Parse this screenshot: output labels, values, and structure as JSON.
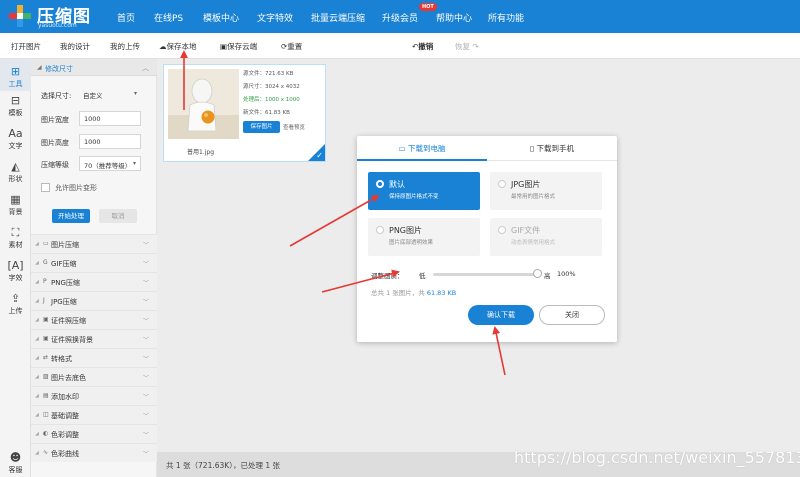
{
  "nav": {
    "logo_text": "压缩图",
    "logo_sub": "yasuotu.com",
    "items": [
      "首页",
      "在线PS",
      "模板中心",
      "文字特效",
      "批量云端压缩",
      "升级会员",
      "帮助中心",
      "所有功能"
    ],
    "hot_badge": "HOT"
  },
  "toolbar": {
    "open": "打开图片",
    "my_design": "我的设计",
    "my_upload": "我的上传",
    "save_local": "保存本地",
    "save_cloud": "保存云端",
    "reset": "重置",
    "undo": "撤销",
    "redo": "恢复"
  },
  "sidebar": [
    {
      "label": "工具",
      "icon": "toolbox-icon"
    },
    {
      "label": "模板",
      "icon": "template-icon"
    },
    {
      "label": "文字",
      "icon": "text-icon"
    },
    {
      "label": "形状",
      "icon": "shape-icon"
    },
    {
      "label": "背景",
      "icon": "background-icon"
    },
    {
      "label": "素材",
      "icon": "material-icon"
    },
    {
      "label": "字效",
      "icon": "font-effect-icon"
    },
    {
      "label": "上传",
      "icon": "upload-icon"
    },
    {
      "label": "客服",
      "icon": "service-icon"
    }
  ],
  "panel": {
    "title": "修改尺寸",
    "size_label": "选择尺寸:",
    "size_value": "自定义",
    "width_label": "图片宽度",
    "width_value": "1000",
    "height_label": "图片高度",
    "height_value": "1000",
    "level_label": "压缩等级",
    "level_value": "70（推荐等级）",
    "allow_label": "允许图片变形",
    "start_btn": "开始处理",
    "cancel_btn": "取消",
    "menu": [
      "图片压缩",
      "GIF压缩",
      "PNG压缩",
      "JPG压缩",
      "证件照压缩",
      "证件照换背景",
      "转格式",
      "图片去底色",
      "添加水印",
      "基础调整",
      "色彩调整",
      "色彩曲线"
    ]
  },
  "card": {
    "orig_size": "源文件：721.63 KB",
    "orig_dim": "源尺寸：3024 x 4032",
    "processed": "处理后：1000 x 1000",
    "new_size": "新文件：61.83 KB",
    "save_btn": "保存图片",
    "preview": "查看预览",
    "filename": "普用1.jpg"
  },
  "status": "共 1 张（721.63K），已处理 1 张",
  "modal": {
    "tab_pc": "下载到电脑",
    "tab_phone": "下载到手机",
    "options": [
      {
        "title": "默认",
        "desc": "保持原图片格式不变"
      },
      {
        "title": "JPG图片",
        "desc": "最常用的图片格式"
      },
      {
        "title": "PNG图片",
        "desc": "图片底部透明效果"
      },
      {
        "title": "GIF文件",
        "desc": "动态表情常用格式"
      }
    ],
    "quality_label": "调整画质：",
    "low": "低",
    "high": "高",
    "quality_pct": "100%",
    "summary_prefix": "总共 1 张图片，共 ",
    "summary_size": "61.83 KB",
    "confirm": "确认下载",
    "close": "关闭"
  },
  "quality_fraction": 1.0,
  "watermark": "https://blog.csdn.net/weixin_55781396",
  "colors": {
    "accent": "#1a82d4",
    "arrow": "#e53935"
  }
}
